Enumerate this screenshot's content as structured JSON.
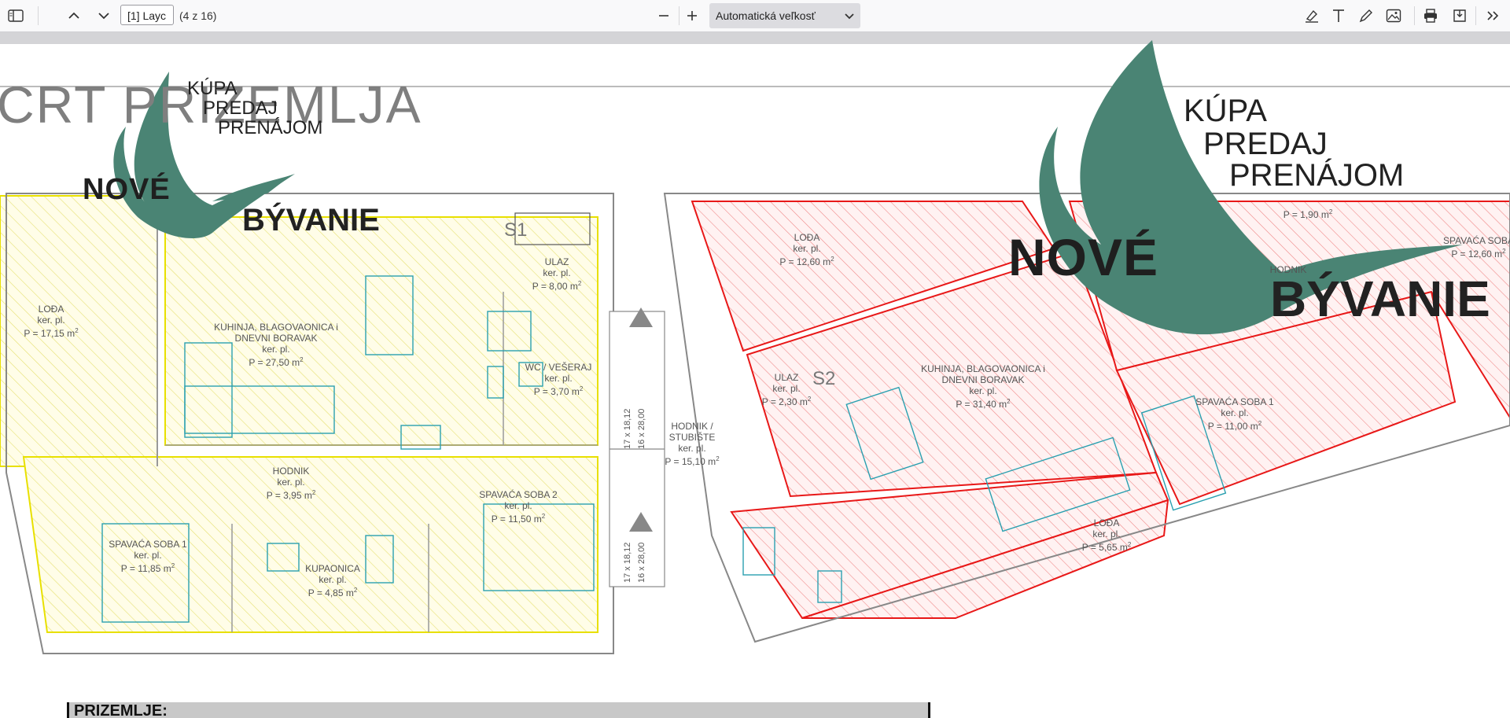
{
  "toolbar": {
    "page_input": "[1] Layc",
    "page_count": "(4 z 16)",
    "zoom_label": "Automatická veľkosť"
  },
  "icons": [
    "sidebar-toggle-icon",
    "chevron-up-icon",
    "chevron-down-icon",
    "minus-icon",
    "plus-icon",
    "chevron-down-icon",
    "highlight-pen-icon",
    "text-icon",
    "draw-icon",
    "image-icon",
    "print-icon",
    "save-icon",
    "double-chevron-right-icon"
  ],
  "document": {
    "big_title": "CRT PRIZEMLJA",
    "bottom_title": "PRIZEMLJE:",
    "s1_label": "S1",
    "s2_label": "S2",
    "left_rooms": [
      {
        "name": "LOĐA",
        "line2": "ker. pl.",
        "area": "P = 17,15 m"
      },
      {
        "name": "KUHINJA, BLAGOVAONICA i",
        "name2": "DNEVNI BORAVAK",
        "line2": "ker. pl.",
        "area": "P = 27,50 m"
      },
      {
        "name": "ULAZ",
        "line2": "ker. pl.",
        "area": "P = 8,00 m"
      },
      {
        "name": "WC / VEŠERAJ",
        "line2": "ker. pl.",
        "area": "P = 3,70 m"
      },
      {
        "name": "HODNIK",
        "line2": "ker. pl.",
        "area": "P = 3,95 m"
      },
      {
        "name": "SPAVAĆA SOBA 2",
        "line2": "ker. pl.",
        "area": "P = 11,50 m"
      },
      {
        "name": "SPAVAĆA SOBA 1",
        "line2": "ker. pl.",
        "area": "P = 11,85 m"
      },
      {
        "name": "KUPAONICA",
        "line2": "ker. pl.",
        "area": "P = 4,85 m"
      }
    ],
    "stair": {
      "name": "HODNIK /",
      "name2": "STUBIŠTE",
      "line2": "ker. pl.",
      "area": "P = 15,10 m",
      "dim1": "17 x 18,12",
      "dim2": "16 x 28,00"
    },
    "right_rooms": [
      {
        "name": "LOĐA",
        "line2": "ker. pl.",
        "area": "P = 12,60 m"
      },
      {
        "name": "ULAZ",
        "line2": "ker. pl.",
        "area": "P = 2,30 m"
      },
      {
        "name": "KUHINJA, BLAGOVAONICA i",
        "name2": "DNEVNI BORAVAK",
        "line2": "ker. pl.",
        "area": "P = 31,40 m"
      },
      {
        "name": "SPAVAĆA SOBA 1",
        "line2": "ker. pl.",
        "area": "P = 11,00 m"
      },
      {
        "name": "LOĐA",
        "line2": "ker. pl.",
        "area": "P = 5,65 m"
      },
      {
        "name": "HODNIK",
        "area": "P = 1,90 m"
      },
      {
        "name": "SPAVAĆA SOBA",
        "area": "P = 12,60 m"
      }
    ]
  },
  "watermark": {
    "line1": "KÚPA",
    "line2": "PREDAJ",
    "line3": "PRENÁJOM",
    "brand1": "NOVÉ",
    "brand2": "BÝVANIE",
    "color": "#4a8474"
  }
}
